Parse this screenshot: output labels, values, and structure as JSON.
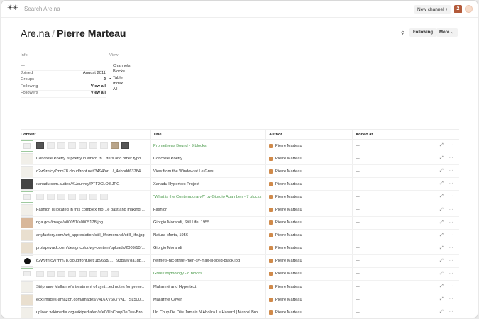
{
  "topbar": {
    "logo": "✳✳",
    "search_placeholder": "Search Are.na",
    "new_channel": "New channel  +",
    "count": "2"
  },
  "header": {
    "site": "Are.na",
    "separator": "/",
    "user": "Pierre Marteau",
    "following": "Following",
    "more": "More  ⌄"
  },
  "info": {
    "label": "Info",
    "bio": "—",
    "rows": [
      {
        "k": "Joined",
        "v": "August 2011"
      },
      {
        "k": "Groups",
        "v": "2"
      },
      {
        "k": "Following",
        "v": "View all"
      },
      {
        "k": "Followers",
        "v": "View all"
      }
    ]
  },
  "view": {
    "label": "View",
    "options": [
      "Channels",
      "Blocks",
      "Table",
      "Index",
      "All"
    ],
    "selected": "Table"
  },
  "table": {
    "columns": [
      "Content",
      "Title",
      "Author",
      "Added at"
    ],
    "rows": [
      {
        "content": "",
        "title": "Prometheus Bound - 9 blocks",
        "link": true,
        "author": "Pierre Marteau",
        "added": "—"
      },
      {
        "content": "Concrete Poetry is poetry in which th…tters and other typo…",
        "title": "Concrete Poetry",
        "link": false,
        "author": "Pierre Marteau",
        "added": "—"
      },
      {
        "content": "d2w9rnfcy7mm78.cloudfront.net/3494/or…/_4ebbdd63784…",
        "title": "View from the Window at Le Gras",
        "link": false,
        "author": "Pierre Marteau",
        "added": "—"
      },
      {
        "content": "xanadu.com.au/ted/XUsurvey/PTF2CLO8.JPG",
        "title": "Xanadu Hypertext Project",
        "link": false,
        "author": "Pierre Marteau",
        "added": "—"
      },
      {
        "content": "",
        "title": "\"What is the Contemporary?\" by Giorgio Agamben - 7 blocks",
        "link": true,
        "author": "Pierre Marteau",
        "added": "—"
      },
      {
        "content": "Fashion is located in this complex mo…e past and making …",
        "title": "Fashion",
        "link": false,
        "author": "Pierre Marteau",
        "added": "—"
      },
      {
        "content": "nga.gov/image/a00051/a0005178.jpg",
        "title": "Giorgio Morandi, Still Life, 1955",
        "link": false,
        "author": "Pierre Marteau",
        "added": "—"
      },
      {
        "content": "artyfactory.com/art_appreciation/still_life/morandi/still_life.jpg",
        "title": "Natura Morta, 1956",
        "link": false,
        "author": "Pierre Marteau",
        "added": "—"
      },
      {
        "content": "profspevack.com/designcolor/wp-content/uploads/2009/10/…",
        "title": "Giorgio Morandi",
        "link": false,
        "author": "Pierre Marteau",
        "added": "—"
      },
      {
        "content": "d2w9rnfcy7mm78.cloudfront.net/189658/…l_93bae78a1db…",
        "title": "helmets-hjc-street-men-sy-max-iii-solid-black.jpg",
        "link": false,
        "author": "Pierre Marteau",
        "added": "—"
      },
      {
        "content": "",
        "title": "Greek Mythology - 8 blocks",
        "link": true,
        "author": "Pierre Marteau",
        "added": "—"
      },
      {
        "content": "Stéphane Mallarmé's treatment of synt…ed notes for prese…",
        "title": "Mallarmé and Hypertext",
        "link": false,
        "author": "Pierre Marteau",
        "added": "—"
      },
      {
        "content": "ecx.images-amazon.com/images/I/416XV6K7VKL._SL500…",
        "title": "Mallarmé Cover",
        "link": false,
        "author": "Pierre Marteau",
        "added": "—"
      },
      {
        "content": "upload.wikimedia.org/wikipedia/en/e/e0/UnCoupDeDes-Bro…",
        "title": "Un Coup De Dés Jamais N'Abolira Le Hasard | Marcel Bro…",
        "link": false,
        "author": "Pierre Marteau",
        "added": "—"
      }
    ]
  },
  "icons": {
    "expand": "⤢",
    "more": "···"
  }
}
